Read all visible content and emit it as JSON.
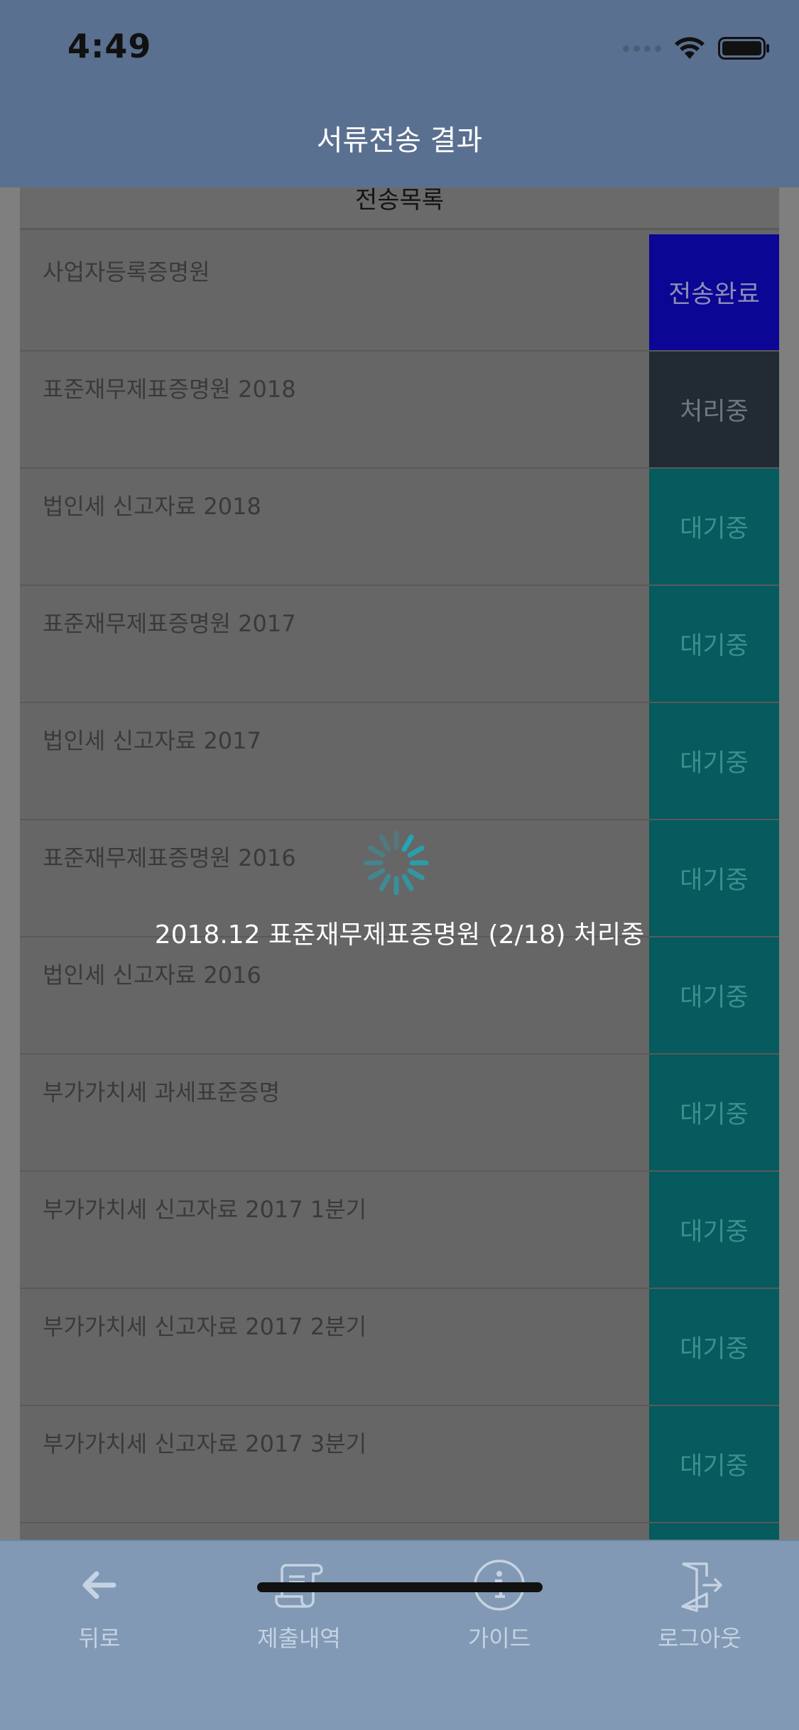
{
  "status_bar": {
    "time": "4:49"
  },
  "nav": {
    "title": "서류전송 결과"
  },
  "list": {
    "header": "전송목록",
    "rows": [
      {
        "label": "사업자등록증명원",
        "status": "전송완료"
      },
      {
        "label": "표준재무제표증명원 2018",
        "status": "처리중"
      },
      {
        "label": "법인세 신고자료 2018",
        "status": "대기중"
      },
      {
        "label": "표준재무제표증명원 2017",
        "status": "대기중"
      },
      {
        "label": "법인세 신고자료 2017",
        "status": "대기중"
      },
      {
        "label": "표준재무제표증명원 2016",
        "status": "대기중"
      },
      {
        "label": "법인세 신고자료 2016",
        "status": "대기중"
      },
      {
        "label": "부가가치세 과세표준증명",
        "status": "대기중"
      },
      {
        "label": "부가가치세 신고자료 2017 1분기",
        "status": "대기중"
      },
      {
        "label": "부가가치세 신고자료 2017 2분기",
        "status": "대기중"
      },
      {
        "label": "부가가치세 신고자료 2017 3분기",
        "status": "대기중"
      }
    ]
  },
  "loading": {
    "message": "2018.12 표준재무제표증명원 (2/18) 처리중"
  },
  "tabbar": {
    "back": {
      "label": "뒤로",
      "icon": "arrow-left-icon"
    },
    "history": {
      "label": "제출내역",
      "icon": "scroll-document-icon"
    },
    "guide": {
      "label": "가이드",
      "icon": "info-circle-icon"
    },
    "logout": {
      "label": "로그아웃",
      "icon": "door-exit-icon"
    }
  },
  "colors": {
    "nav_bg": "#5a7090",
    "tabbar_bg": "#8199b4",
    "status_done": "#0b0693",
    "status_processing": "#222a33",
    "status_waiting": "#055b5d",
    "spinner": "#1fa9b8"
  }
}
